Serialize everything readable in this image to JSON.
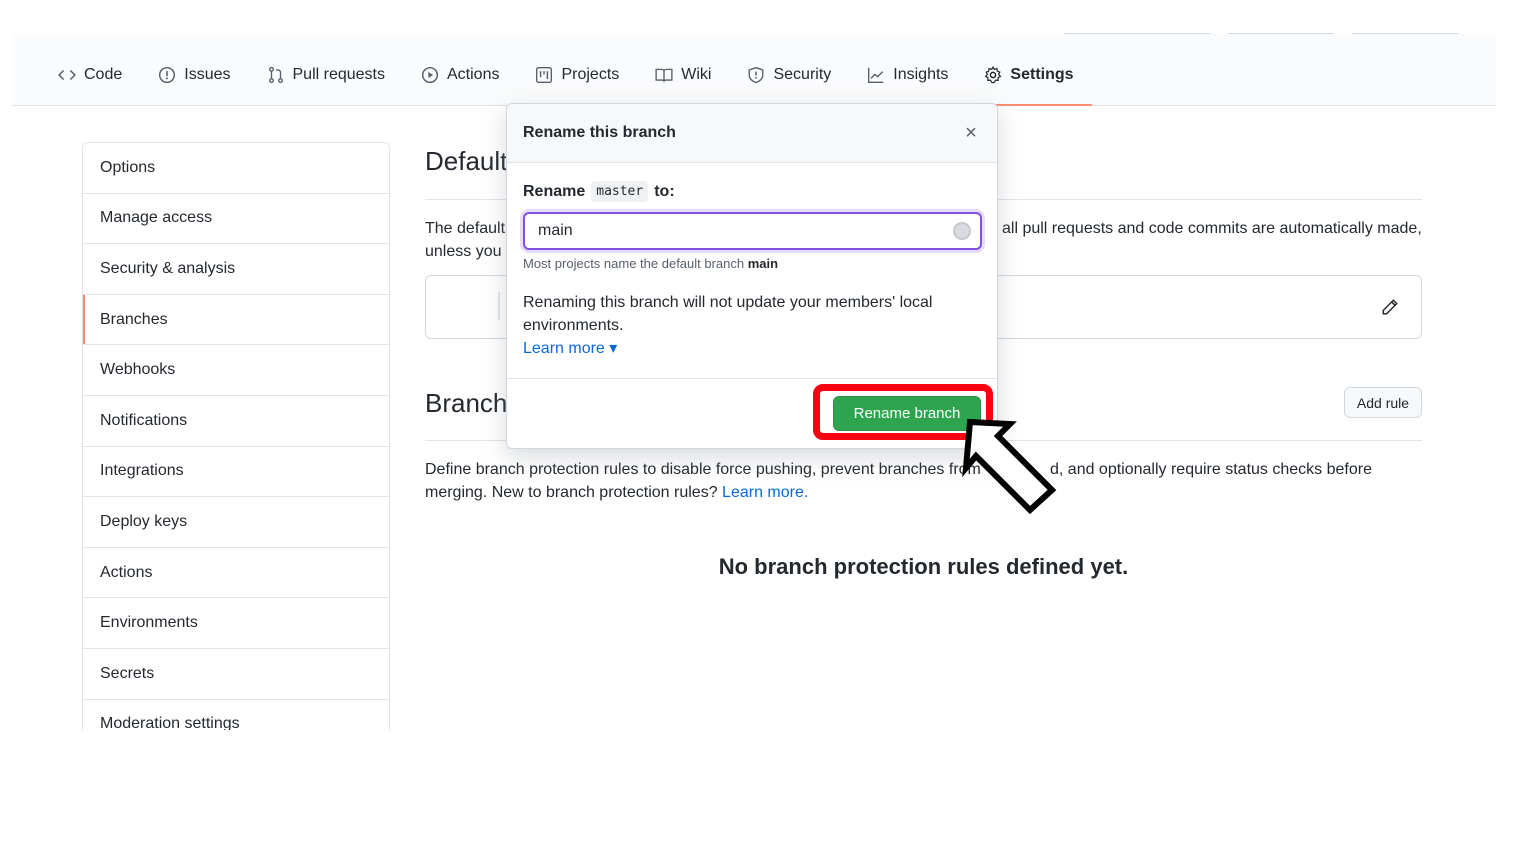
{
  "nav": {
    "tabs": [
      {
        "label": "Code",
        "icon": "code-icon"
      },
      {
        "label": "Issues",
        "icon": "issue-icon"
      },
      {
        "label": "Pull requests",
        "icon": "pull-request-icon"
      },
      {
        "label": "Actions",
        "icon": "play-icon"
      },
      {
        "label": "Projects",
        "icon": "project-icon"
      },
      {
        "label": "Wiki",
        "icon": "book-icon"
      },
      {
        "label": "Security",
        "icon": "shield-icon"
      },
      {
        "label": "Insights",
        "icon": "graph-icon"
      },
      {
        "label": "Settings",
        "icon": "gear-icon"
      }
    ],
    "selected": "Settings"
  },
  "sidebar": {
    "items": [
      {
        "label": "Options"
      },
      {
        "label": "Manage access"
      },
      {
        "label": "Security & analysis"
      },
      {
        "label": "Branches"
      },
      {
        "label": "Webhooks"
      },
      {
        "label": "Notifications"
      },
      {
        "label": "Integrations"
      },
      {
        "label": "Deploy keys"
      },
      {
        "label": "Actions"
      },
      {
        "label": "Environments"
      },
      {
        "label": "Secrets"
      },
      {
        "label": "Moderation settings"
      }
    ],
    "active": "Branches"
  },
  "main": {
    "default_title": "Default",
    "default_text_left": "The default",
    "default_text_left2": "unless you s",
    "default_text_right": "all pull requests and code commits are automatically made,",
    "branch_title": "Branch",
    "add_rule": "Add rule",
    "protection_text": "Define branch protection rules to disable force pushing, prevent branches from",
    "protection_text_tail": "d, and optionally require status checks before",
    "protection_text2": "merging. New to branch protection rules?",
    "learn_more_link": "Learn more.",
    "empty_state": "No branch protection rules defined yet."
  },
  "modal": {
    "title": "Rename this branch",
    "close": "×",
    "rename_prefix": "Rename",
    "current_branch": "master",
    "rename_suffix": "to:",
    "input_value": "main",
    "hint_prefix": "Most projects name the default branch",
    "hint_branch": "main",
    "warning": "Renaming this branch will not update your members' local environments.",
    "learn_more": "Learn more ▾",
    "submit": "Rename branch"
  },
  "colors": {
    "accent_tab": "#fd8c73",
    "primary_button": "#2ea44f",
    "highlight_frame": "#ff0010",
    "input_focus": "#8250df",
    "link": "#0969da"
  }
}
